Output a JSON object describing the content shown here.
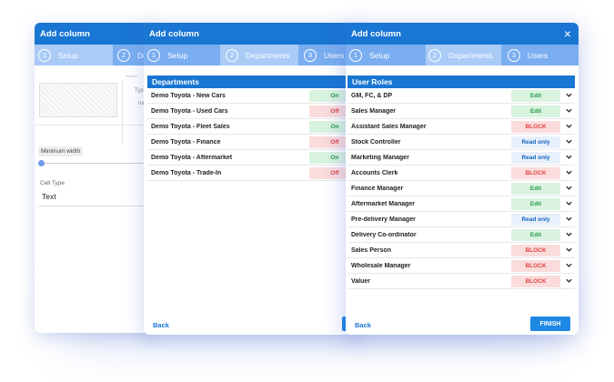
{
  "colors": {
    "primary": "#1976d2",
    "steps_bar": "#7aaef0",
    "step_active": "#a9cbf6",
    "on_bg": "#d9f3e0",
    "on_fg": "#2a9a47",
    "off_bg": "#fbdcdc",
    "off_fg": "#e04444",
    "readonly_fg": "#1565c0"
  },
  "dialog1": {
    "title": "Add column",
    "steps": [
      {
        "num": "1",
        "label": "Setup"
      },
      {
        "num": "2",
        "label": "De"
      }
    ],
    "faint_header": "Header",
    "faint_type": "Typ",
    "faint_name": "na",
    "min_width_label": "Minimum width",
    "min_width_value": 0,
    "cell_type_label": "Cell Type",
    "cell_type_value": "Text"
  },
  "dialog2": {
    "title": "Add column",
    "steps": [
      {
        "num": "1",
        "label": "Setup"
      },
      {
        "num": "2",
        "label": "Departments"
      },
      {
        "num": "3",
        "label": "Users"
      }
    ],
    "section_title": "Departments",
    "departments": [
      {
        "name": "Demo Toyota - New Cars",
        "status": "On"
      },
      {
        "name": "Demo Toyota - Used Cars",
        "status": "Off"
      },
      {
        "name": "Demo Toyota - Fleet Sales",
        "status": "On"
      },
      {
        "name": "Demo Toyota - Finance",
        "status": "Off"
      },
      {
        "name": "Demo Toyota - Aftermarket",
        "status": "On"
      },
      {
        "name": "Demo Toyota - Trade-In",
        "status": "Off"
      }
    ],
    "back_label": "Back",
    "next_label": "N"
  },
  "dialog3": {
    "title": "Add column",
    "close_icon": "×",
    "steps": [
      {
        "num": "1",
        "label": "Setup"
      },
      {
        "num": "2",
        "label": "Departments"
      },
      {
        "num": "3",
        "label": "Users"
      }
    ],
    "section_title": "User Roles",
    "roles": [
      {
        "name": "GM, FC, & DP",
        "access": "Edit"
      },
      {
        "name": "Sales Manager",
        "access": "Edit"
      },
      {
        "name": "Assistant Sales Manager",
        "access": "BLOCK"
      },
      {
        "name": "Stock Controller",
        "access": "Read only"
      },
      {
        "name": "Marketing Manager",
        "access": "Read only"
      },
      {
        "name": "Accounts Clerk",
        "access": "BLOCK"
      },
      {
        "name": "Finance Manager",
        "access": "Edit"
      },
      {
        "name": "Aftermarket Manager",
        "access": "Edit"
      },
      {
        "name": "Pre-delivery Manager",
        "access": "Read only"
      },
      {
        "name": "Delivery Co-ordinator",
        "access": "Edit"
      },
      {
        "name": "Sales Person",
        "access": "BLOCK"
      },
      {
        "name": "Wholesale Manager",
        "access": "BLOCK"
      },
      {
        "name": "Valuer",
        "access": "BLOCK"
      }
    ],
    "back_label": "Back",
    "finish_label": "FINISH"
  }
}
